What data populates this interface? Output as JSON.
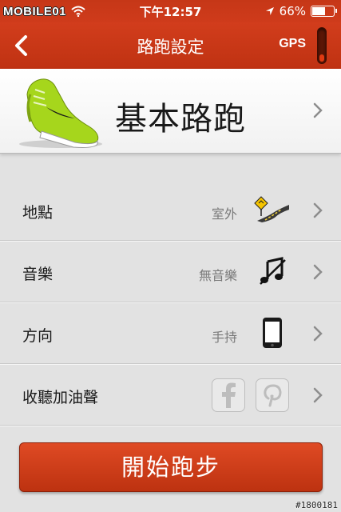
{
  "status_bar": {
    "brand": "MOBILE01",
    "time": "下午12:57",
    "battery_percent": "66%",
    "battery_level": 0.66,
    "icons": [
      "wifi-icon",
      "location-arrow-icon",
      "battery-icon"
    ]
  },
  "nav": {
    "title": "路跑設定",
    "gps_label": "GPS",
    "gps_signal_level": 0.3,
    "icons": [
      "back-chevron-icon"
    ]
  },
  "run_type": {
    "title": "基本路跑",
    "icon": "running-shoe-icon"
  },
  "settings": [
    {
      "label": "地點",
      "value": "室外",
      "icon": "road-sign-icon"
    },
    {
      "label": "音樂",
      "value": "無音樂",
      "icon": "music-off-icon"
    },
    {
      "label": "方向",
      "value": "手持",
      "icon": "phone-icon"
    },
    {
      "label": "收聽加油聲",
      "value": "",
      "icon": "facebook-pinterest-icons"
    }
  ],
  "start_button": {
    "label": "開始跑步"
  },
  "watermark": "#1800181",
  "colors": {
    "accent": "#c63717",
    "shoe": "#a6d61c"
  }
}
